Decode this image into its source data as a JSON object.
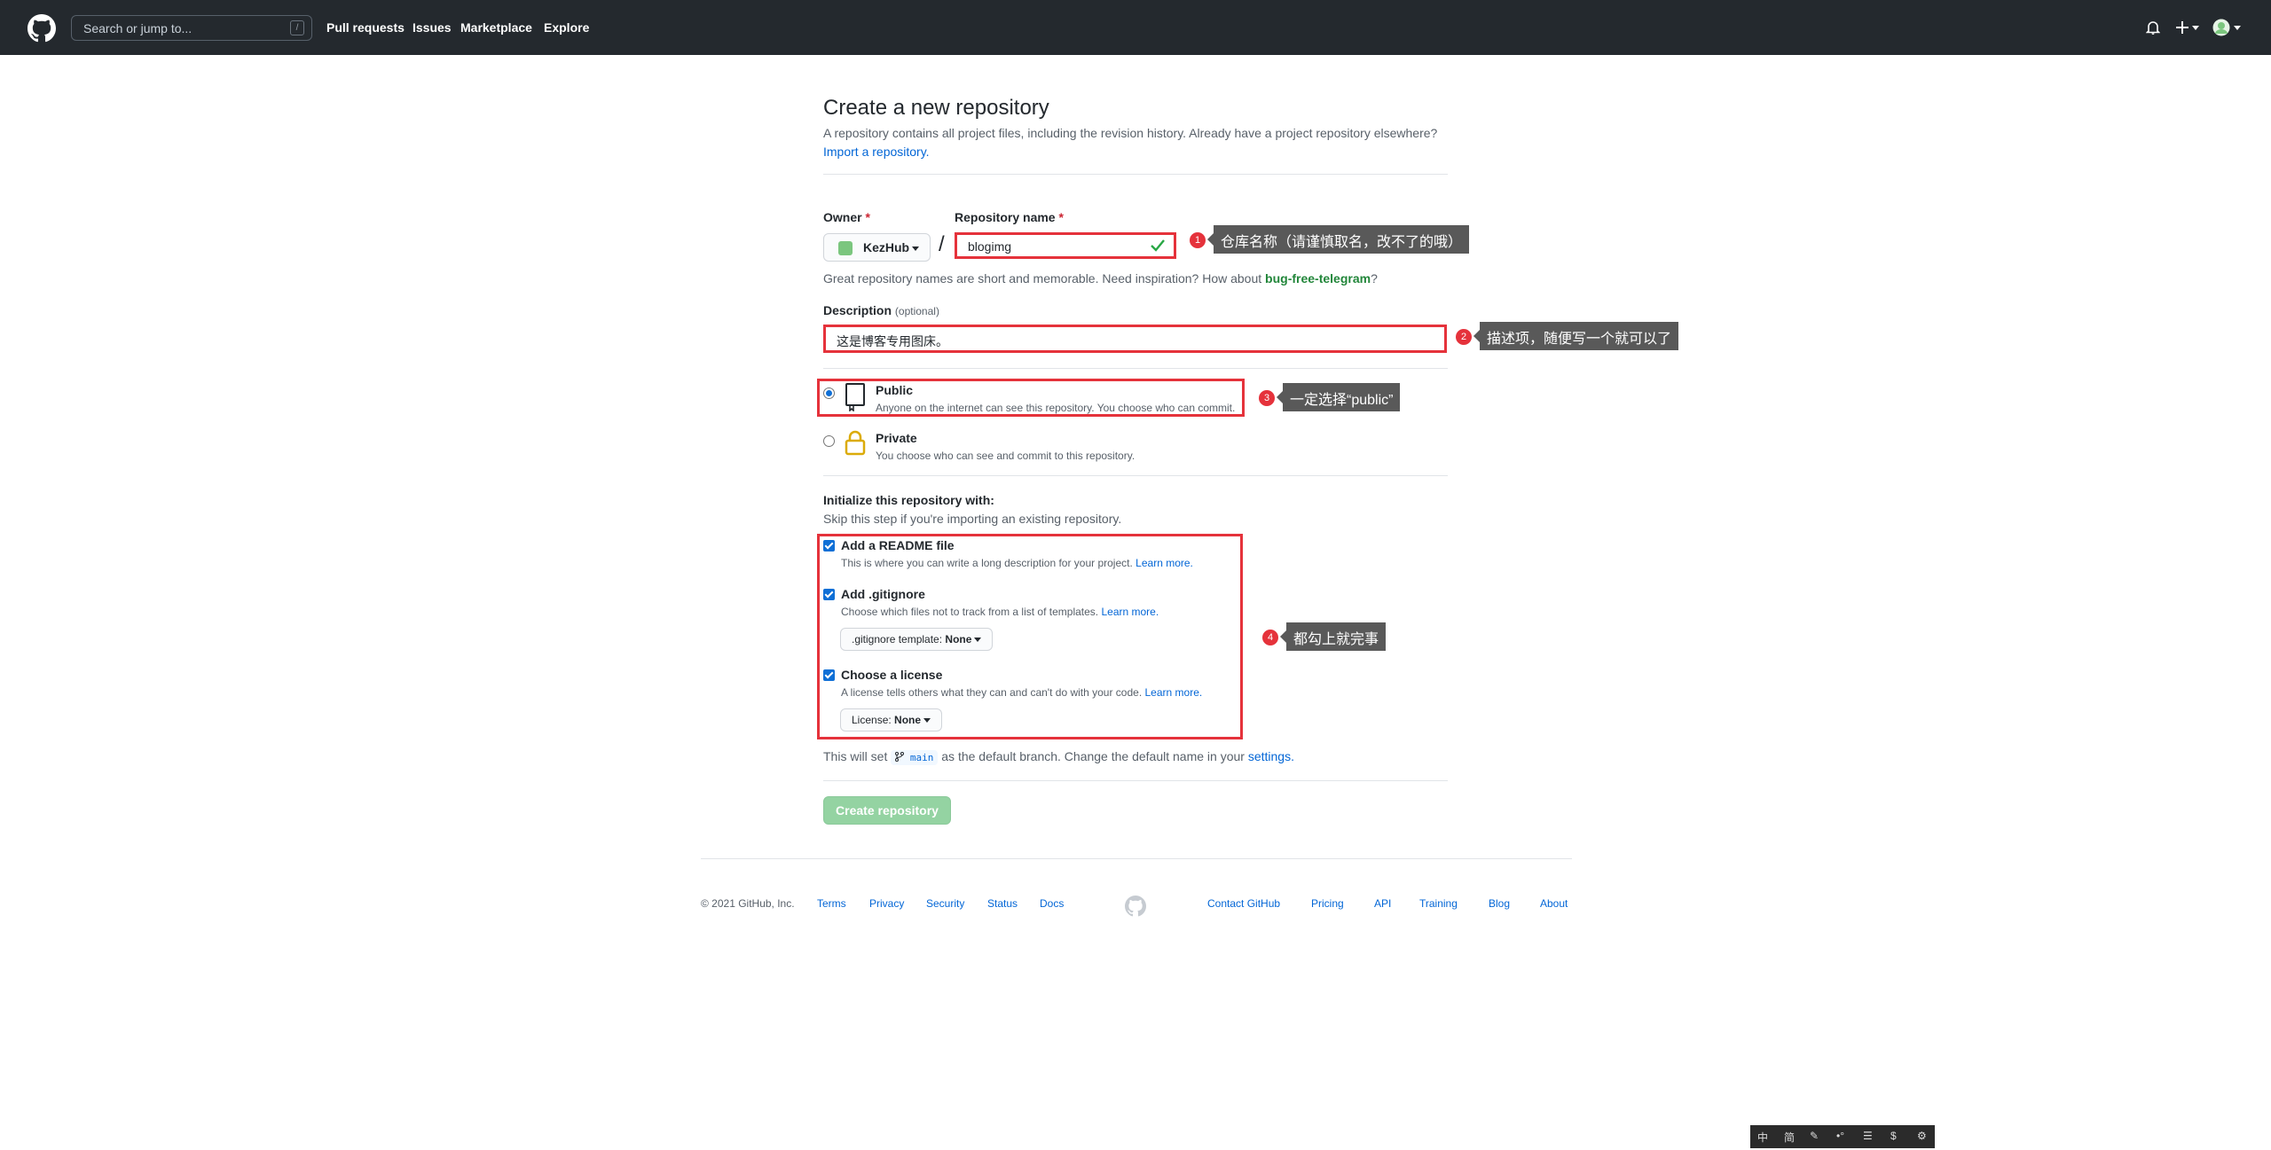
{
  "header": {
    "search_placeholder": "Search or jump to...",
    "search_shortcut": "/",
    "nav": [
      "Pull requests",
      "Issues",
      "Marketplace",
      "Explore"
    ]
  },
  "form": {
    "title": "Create a new repository",
    "subtitle": "A repository contains all project files, including the revision history. Already have a project repository elsewhere?",
    "import_link": "Import a repository.",
    "owner_label": "Owner",
    "repo_label": "Repository name",
    "required_mark": "*",
    "owner_value": "KezHub",
    "slash": "/",
    "repo_value": "blogimg",
    "hint_prefix": "Great repository names are short and memorable. Need inspiration? How about",
    "hint_suggestion": "bug-free-telegram",
    "hint_suffix": "?",
    "description_label": "Description",
    "description_optional": "(optional)",
    "description_value": "这是博客专用图床。",
    "public_title": "Public",
    "public_desc": "Anyone on the internet can see this repository. You choose who can commit.",
    "private_title": "Private",
    "private_desc": "You choose who can see and commit to this repository.",
    "init_title": "Initialize this repository with:",
    "init_sub": "Skip this step if you're importing an existing repository.",
    "readme_title": "Add a README file",
    "readme_desc": "This is where you can write a long description for your project.",
    "gitignore_title": "Add .gitignore",
    "gitignore_desc": "Choose which files not to track from a list of templates.",
    "gitignore_select_label": ".gitignore template:",
    "gitignore_select_value": "None",
    "license_title": "Choose a license",
    "license_desc": "A license tells others what they can and can't do with your code.",
    "license_select_label": "License:",
    "license_select_value": "None",
    "learn_more": "Learn more.",
    "branch_prefix": "This will set",
    "branch_name": "main",
    "branch_suffix": "as the default branch. Change the default name in your",
    "branch_link": "settings.",
    "create_button": "Create repository"
  },
  "annotations": [
    {
      "num": "1",
      "text": "仓库名称（请谨慎取名，改不了的哦）"
    },
    {
      "num": "2",
      "text": "描述项，随便写一个就可以了"
    },
    {
      "num": "3",
      "text": "一定选择“public”"
    },
    {
      "num": "4",
      "text": "都勾上就完事"
    }
  ],
  "footer": {
    "copyright": "© 2021 GitHub, Inc.",
    "left_links": [
      "Terms",
      "Privacy",
      "Security",
      "Status",
      "Docs"
    ],
    "right_links": [
      "Contact GitHub",
      "Pricing",
      "API",
      "Training",
      "Blog",
      "About"
    ]
  },
  "ime_toolbar": [
    "中",
    "简",
    "✎",
    "•°",
    "☰",
    "$",
    "⚙"
  ],
  "colors": {
    "header_bg": "#24292e",
    "annotation_red": "#e5323b",
    "link_blue": "#0366d6",
    "create_button_green": "#94d3a2",
    "suggestion_green": "#22863a"
  }
}
